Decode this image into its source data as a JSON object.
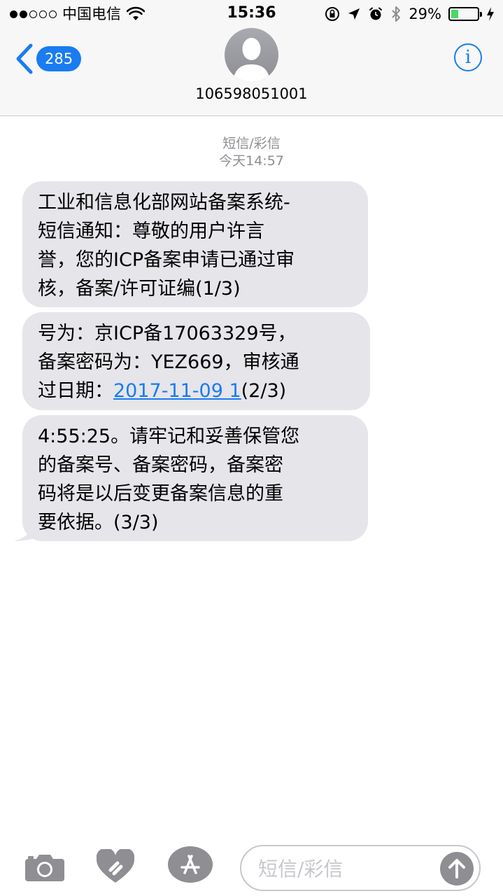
{
  "status_bar": {
    "carrier": "中国电信",
    "time": "15:36",
    "battery_percent": "29%",
    "battery_level": 0.29,
    "signal_bars_filled": 2,
    "signal_bars_total": 5
  },
  "nav": {
    "back_count": "285",
    "contact": "106598051001"
  },
  "thread": {
    "message_type": "短信/彩信",
    "timestamp": "今天14:57"
  },
  "messages": [
    {
      "lines": [
        "工业和信息化部网站备案系统-",
        "短信通知：尊敬的用户许言",
        "誉，您的ICP备案申请已通过审",
        "核，备案/许可证编(1/3)"
      ]
    },
    {
      "line1": "号为：京ICP备17063329号，",
      "line2": "备案密码为：YEZ669，审核通",
      "line3_prefix": "过日期：",
      "line3_link": "2017-11-09 1",
      "line3_suffix": "(2/3)"
    },
    {
      "lines": [
        "4:55:25。请牢记和妥善保管您",
        "的备案号、备案密码，备案密",
        "码将是以后变更备案信息的重",
        "要依据。(3/3)"
      ]
    }
  ],
  "input": {
    "placeholder": "短信/彩信"
  },
  "icons": [
    "camera-icon",
    "digital-touch-icon",
    "app-store-icon",
    "send-arrow-icon",
    "info-icon",
    "back-chevron-icon"
  ],
  "colors": {
    "accent": "#1a7cf0",
    "bubble": "#e5e5ea",
    "battery": "#4cd964"
  }
}
